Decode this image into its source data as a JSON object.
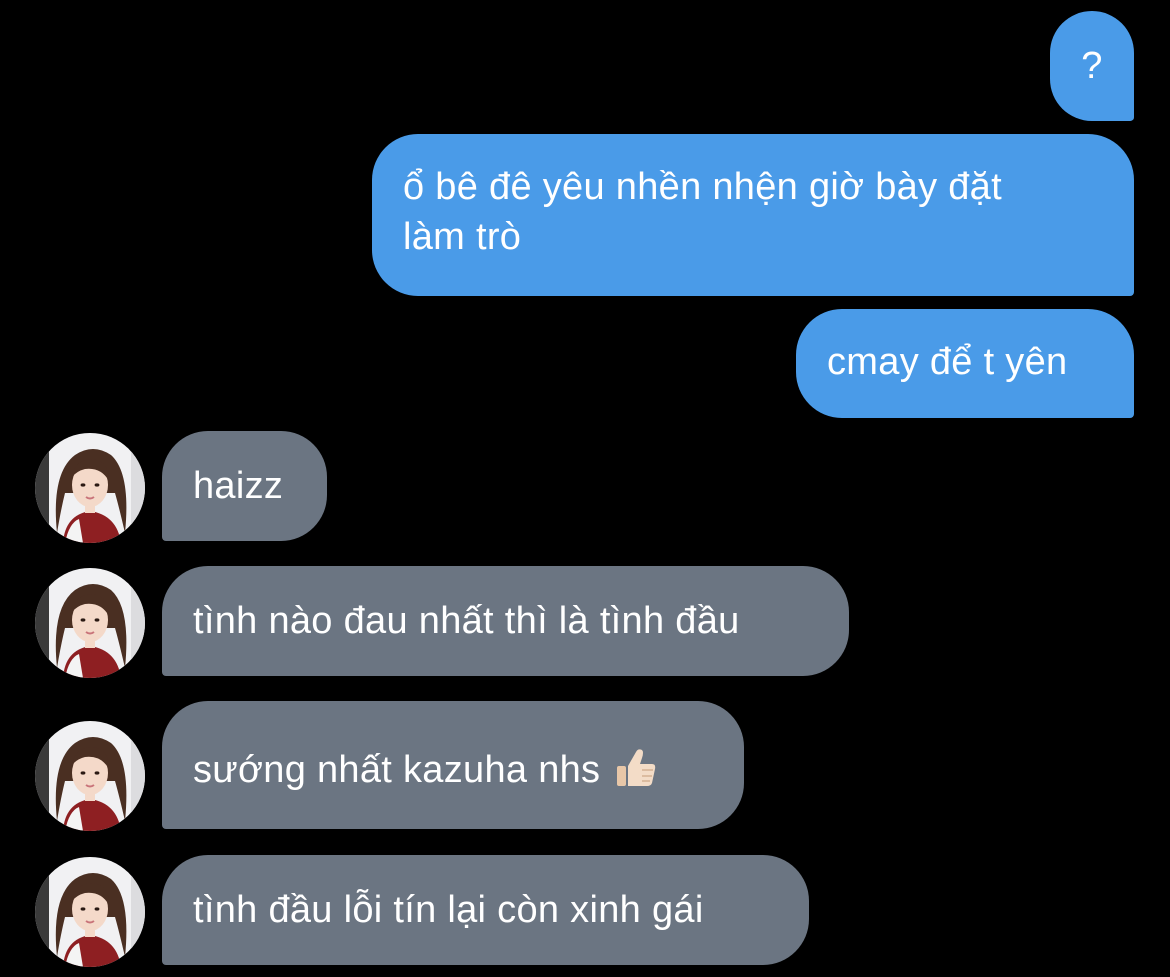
{
  "colors": {
    "background": "#000000",
    "sent_bubble": "#4a9be8",
    "received_bubble": "#6b7582",
    "text": "#ffffff"
  },
  "messages": [
    {
      "direction": "sent",
      "text": "?"
    },
    {
      "direction": "sent",
      "line1": "ổ bê đê yêu nhền nhện giờ bày đặt",
      "line2": "làm trò"
    },
    {
      "direction": "sent",
      "text": "cmay để t yên"
    },
    {
      "direction": "received",
      "text": "haizz",
      "avatar": "contact-avatar"
    },
    {
      "direction": "received",
      "text": "tình nào đau nhất thì là tình đầu",
      "avatar": "contact-avatar"
    },
    {
      "direction": "received",
      "text": "sướng nhất kazuha nhs",
      "emoji": "thumbs-up-icon",
      "avatar": "contact-avatar"
    },
    {
      "direction": "received",
      "text": "tình đầu lỗi tín lại còn xinh gái",
      "avatar": "contact-avatar"
    }
  ]
}
